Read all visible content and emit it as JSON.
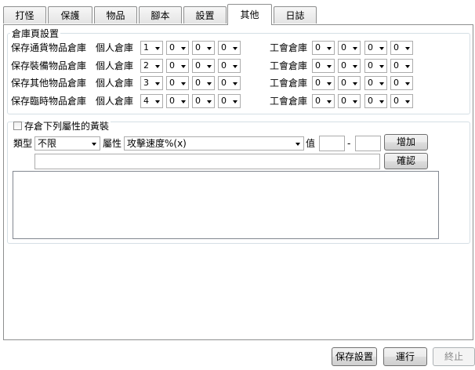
{
  "tabs": [
    {
      "label": "打怪",
      "active": false
    },
    {
      "label": "保護",
      "active": false
    },
    {
      "label": "物品",
      "active": false
    },
    {
      "label": "腳本",
      "active": false
    },
    {
      "label": "設置",
      "active": false
    },
    {
      "label": "其他",
      "active": true
    },
    {
      "label": "日誌",
      "active": false
    }
  ],
  "warehouse": {
    "title": "倉庫頁設置",
    "personal_label": "個人倉庫",
    "guild_label": "工會倉庫",
    "rows": [
      {
        "label": "保存通貨物品倉庫",
        "personal": [
          "1",
          "0",
          "0",
          "0"
        ],
        "guild": [
          "0",
          "0",
          "0",
          "0"
        ]
      },
      {
        "label": "保存裝備物品倉庫",
        "personal": [
          "2",
          "0",
          "0",
          "0"
        ],
        "guild": [
          "0",
          "0",
          "0",
          "0"
        ]
      },
      {
        "label": "保存其他物品倉庫",
        "personal": [
          "3",
          "0",
          "0",
          "0"
        ],
        "guild": [
          "0",
          "0",
          "0",
          "0"
        ]
      },
      {
        "label": "保存臨時物品倉庫",
        "personal": [
          "4",
          "0",
          "0",
          "0"
        ],
        "guild": [
          "0",
          "0",
          "0",
          "0"
        ]
      }
    ]
  },
  "attr": {
    "checkbox_label": "存倉下列屬性的黃裝",
    "type_label": "類型",
    "type_value": "不限",
    "attr_label": "屬性",
    "attr_value": "攻擊速度%(x)",
    "value_label": "值",
    "dash": "-",
    "add_label": "增加",
    "confirm_label": "確認"
  },
  "footer": {
    "save_label": "保存設置",
    "run_label": "運行",
    "stop_label": "終止"
  }
}
